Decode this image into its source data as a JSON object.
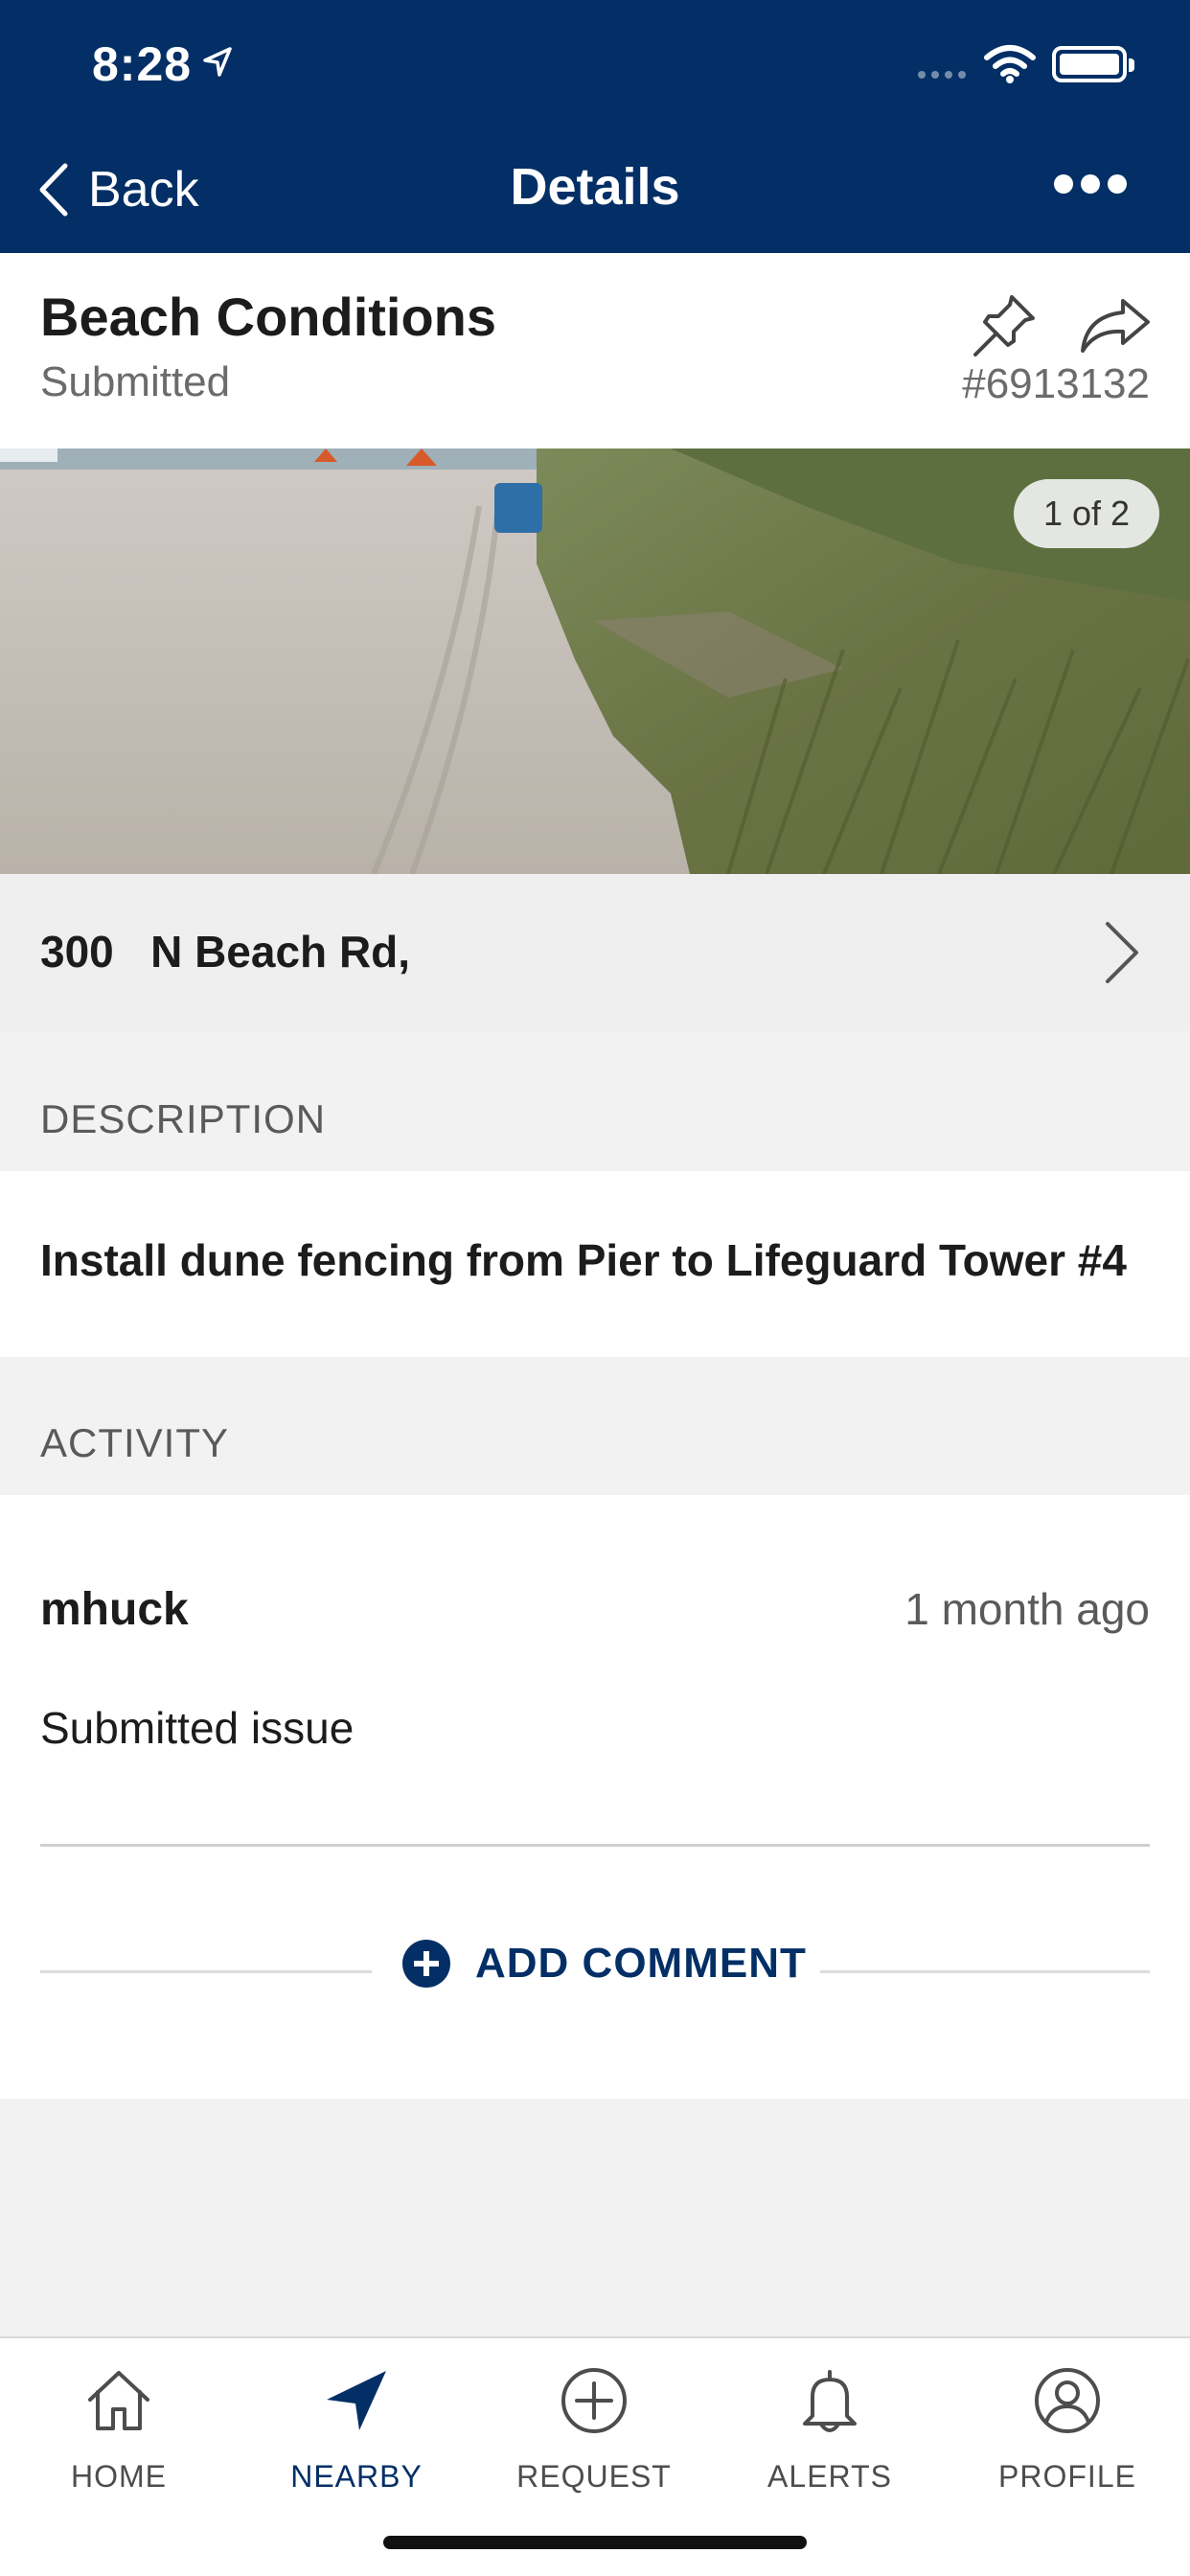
{
  "status_bar": {
    "time": "8:28"
  },
  "nav": {
    "back_label": "Back",
    "title": "Details"
  },
  "issue": {
    "title": "Beach Conditions",
    "status": "Submitted",
    "id": "#6913132",
    "photo_counter": "1 of 2",
    "address": "300   N Beach Rd,"
  },
  "description": {
    "label": "DESCRIPTION",
    "text": "Install dune fencing from Pier to Lifeguard Tower #4"
  },
  "activity": {
    "label": "ACTIVITY",
    "entries": [
      {
        "user": "mhuck",
        "time": "1 month ago",
        "text": "Submitted issue"
      }
    ],
    "add_comment_label": "ADD COMMENT"
  },
  "tabbar": {
    "tabs": [
      {
        "label": "HOME",
        "icon": "home-icon"
      },
      {
        "label": "NEARBY",
        "icon": "navigation-arrow-icon",
        "active": true
      },
      {
        "label": "REQUEST",
        "icon": "plus-circle-icon"
      },
      {
        "label": "ALERTS",
        "icon": "bell-icon"
      },
      {
        "label": "PROFILE",
        "icon": "user-icon"
      }
    ]
  },
  "colors": {
    "primary": "#032f66",
    "background": "#f2f2f2",
    "text": "#1c1c1c",
    "muted": "#6b6b6b"
  }
}
